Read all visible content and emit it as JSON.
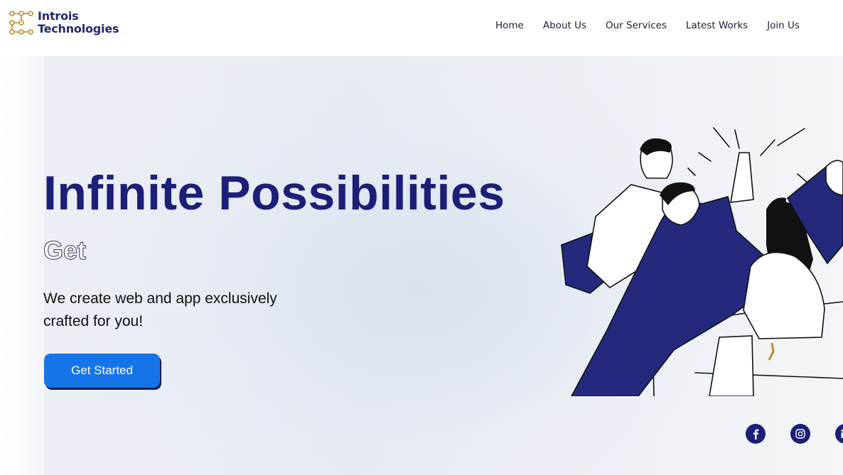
{
  "brand": {
    "line1": "Introis",
    "line2": "Technologies"
  },
  "nav": {
    "items": [
      {
        "label": "Home"
      },
      {
        "label": "About Us"
      },
      {
        "label": "Our Services"
      },
      {
        "label": "Latest Works"
      },
      {
        "label": "Join Us"
      }
    ]
  },
  "hero": {
    "headline": "Infinite Possibilities",
    "typed_text": "Get",
    "tagline": "We create web and app exclusively crafted for you!",
    "cta_label": "Get Started"
  },
  "social": {
    "icons": [
      "facebook-icon",
      "instagram-icon",
      "linkedin-icon"
    ]
  },
  "colors": {
    "brand_navy": "#1c1f78",
    "cta_blue": "#1674e8",
    "logo_gold": "#c48a2c"
  }
}
